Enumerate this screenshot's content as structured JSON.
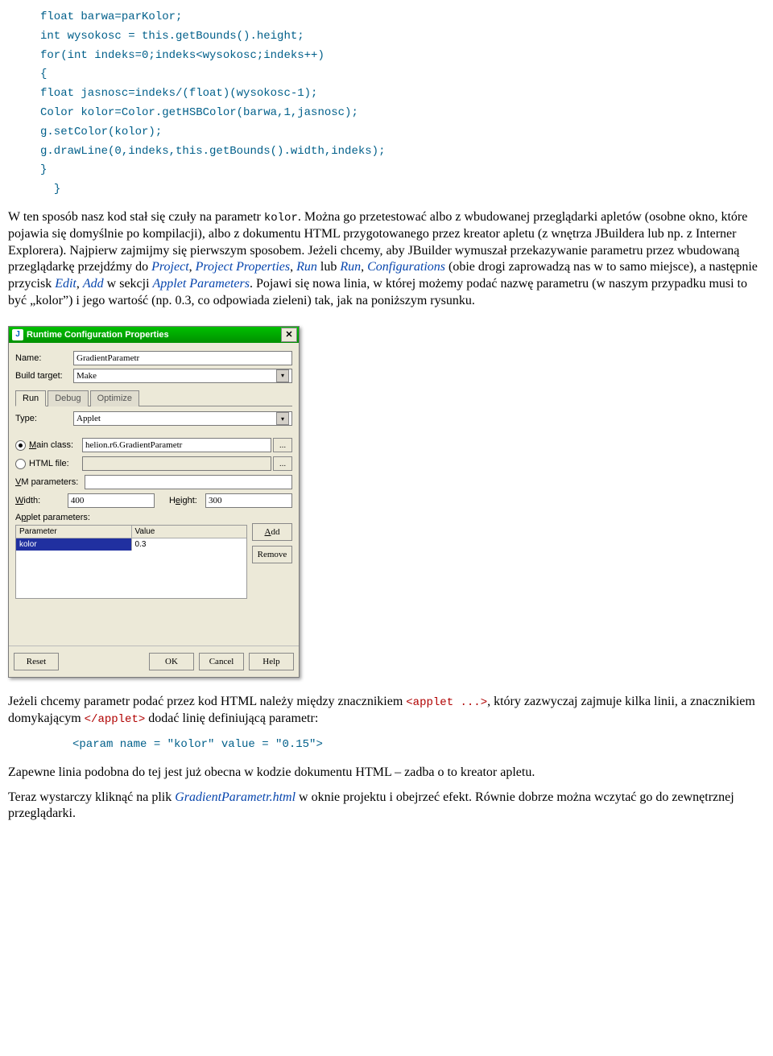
{
  "code1": {
    "l1": "float barwa=parKolor;",
    "l2": "int wysokosc = this.getBounds().height;",
    "l3": "for(int indeks=0;indeks<wysokosc;indeks++)",
    "l4": "{",
    "l5": "float jasnosc=indeks/(float)(wysokosc-1);",
    "l6": "Color kolor=Color.getHSBColor(barwa,1,jasnosc);",
    "l7": "g.setColor(kolor);",
    "l8": "g.drawLine(0,indeks,this.getBounds().width,indeks);",
    "l9": "}",
    "l10": "}"
  },
  "para1": {
    "t1": "W ten sposób nasz kod stał się czuły na parametr ",
    "mono1": "kolor",
    "t2": ". Można go przetestować albo z wbudowanej przeglądarki apletów (osobne okno, które pojawia się domyślnie po kompilacji), albo z dokumentu HTML przygotowanego przez kreator apletu (z wnętrza JBuildera lub np. z Interner Explorera). Najpierw zajmijmy się pierwszym sposobem. Jeżeli chcemy, aby JBuilder wymuszał przekazywanie parametru przez wbudowaną przeglądarkę przejdźmy do ",
    "i1": "Project",
    "t3": ", ",
    "i2": "Project Properties",
    "t4": ", ",
    "i3": "Run",
    "t5": " lub ",
    "i4": "Run",
    "t6": ", ",
    "i5": "Configurations",
    "t7": " (obie drogi zaprowadzą nas w to samo miejsce), a następnie przycisk ",
    "i6": "Edit",
    "t8": ", ",
    "i7": "Add",
    "t9": " w sekcji ",
    "i8": "Applet Parameters",
    "t10": ". Pojawi się nowa linia, w której możemy podać nazwę parametru (w naszym przypadku musi to być „kolor”) i jego wartość (np. 0.3, co odpowiada zieleni) tak, jak na poniższym rysunku."
  },
  "dialog": {
    "title": "Runtime Configuration Properties",
    "nameLabel": "Name:",
    "nameVal": "GradientParametr",
    "buildLabel": "Build target:",
    "buildVal": "Make",
    "tabs": {
      "run": "Run",
      "debug": "Debug",
      "optimize": "Optimize"
    },
    "typeLabel": "Type:",
    "typeVal": "Applet",
    "mainClassLabel": "Main class:",
    "mainClassVal": "helion.r6.GradientParametr",
    "htmlFileLabel": "HTML file:",
    "vmLabel": "VM parameters:",
    "widthLabel": "Width:",
    "widthVal": "400",
    "heightLabel": "Height:",
    "heightVal": "300",
    "appletParamsLabel": "Applet parameters:",
    "paramHeader": "Parameter",
    "valueHeader": "Value",
    "paramName": "kolor",
    "paramVal": "0.3",
    "addBtn": "Add",
    "removeBtn": "Remove",
    "resetBtn": "Reset",
    "okBtn": "OK",
    "cancelBtn": "Cancel",
    "helpBtn": "Help",
    "ellipsis": "..."
  },
  "para2": {
    "t1": "Jeżeli chcemy parametr podać przez kod HTML należy między znacznikiem ",
    "c1": "<applet ...>",
    "t2": ", który zazwyczaj zajmuje kilka linii, a znacznikiem domykającym ",
    "c2": "</applet>",
    "t3": " dodać linię definiującą parametr:"
  },
  "code2": "<param name = \"kolor\" value = \"0.15\">",
  "para3": "Zapewne linia podobna do tej jest już obecna w kodzie dokumentu HTML – zadba o to kreator apletu.",
  "para4": {
    "t1": "Teraz wystarczy kliknąć na plik ",
    "i1": "GradientParametr.html",
    "t2": " w oknie projektu i obejrzeć efekt. Równie dobrze można wczytać go do zewnętrznej przeglądarki."
  }
}
